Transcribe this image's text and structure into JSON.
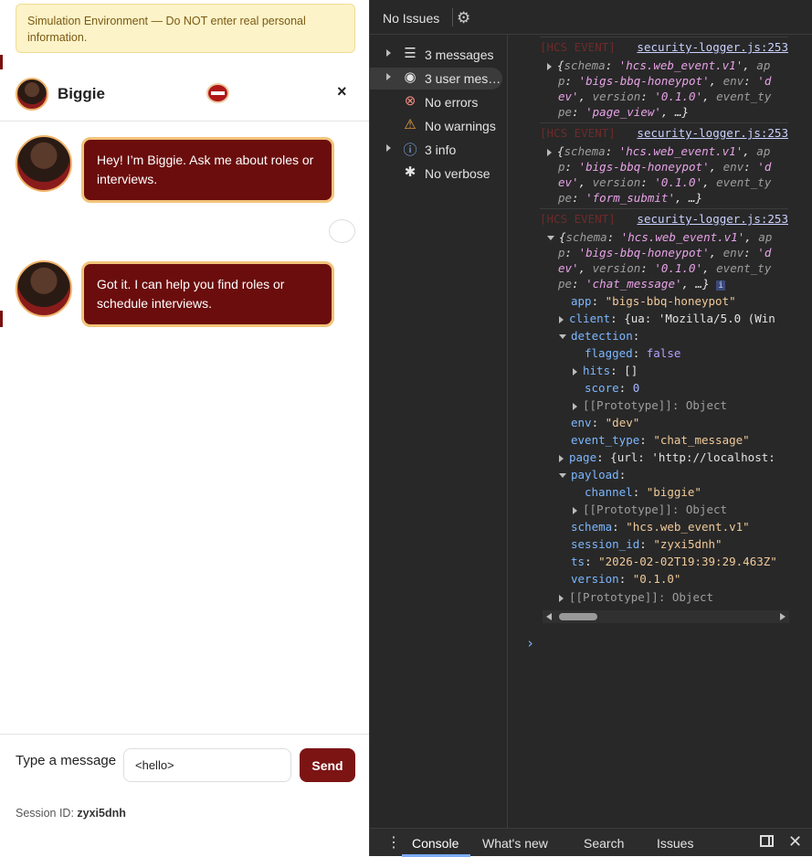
{
  "chat": {
    "banner": "Simulation Environment — Do NOT enter real personal information.",
    "bot_name": "Biggie",
    "close_glyph": "×",
    "messages": [
      {
        "text": "Hey! I’m Biggie. Ask me about roles or interviews."
      },
      {
        "text": "Got it. I can help you find roles or schedule interviews."
      }
    ],
    "composer_label": "Type a message",
    "input_value": "<hello>",
    "send_label": "Send",
    "session_label": "Session ID:",
    "session_id": "zyxi5dnh"
  },
  "devtools": {
    "issues_label": "No Issues",
    "gear_icon": "gear-icon",
    "sidebar": [
      {
        "icon": "list-icon",
        "glyph": "☰",
        "label": "3 messages",
        "expandable": true,
        "selected": false
      },
      {
        "icon": "user-icon",
        "glyph": "◉",
        "label": "3 user mes…",
        "expandable": true,
        "selected": true
      },
      {
        "icon": "error-icon",
        "glyph": "⊗",
        "label": "No errors",
        "expandable": false,
        "selected": false
      },
      {
        "icon": "warning-icon",
        "glyph": "⚠",
        "label": "No warnings",
        "expandable": false,
        "selected": false
      },
      {
        "icon": "info-icon",
        "glyph": "ⓘ",
        "label": "3 info",
        "expandable": true,
        "selected": false
      },
      {
        "icon": "bug-icon",
        "glyph": "✱",
        "label": "No verbose",
        "expandable": false,
        "selected": false
      }
    ],
    "logs": [
      {
        "tag": "[HCS EVENT]",
        "source": "security-logger.js:253",
        "event_type": "page_view"
      },
      {
        "tag": "[HCS EVENT]",
        "source": "security-logger.js:253",
        "event_type": "form_submit"
      },
      {
        "tag": "[HCS EVENT]",
        "source": "security-logger.js:253",
        "event_type": "chat_message"
      }
    ],
    "summary": {
      "schema": "hcs.web_event.v1",
      "app": "bigs-bbq-honeypot",
      "env": "dev",
      "version": "0.1.0"
    },
    "expanded": {
      "app": "\"bigs-bbq-honeypot\"",
      "client": "{ua: 'Mozilla/5.0 (Win",
      "flagged": "false",
      "hits": "[]",
      "score": "0",
      "prototype": "[[Prototype]]: Object",
      "env": "\"dev\"",
      "event_type": "\"chat_message\"",
      "page": "{url: 'http://localhost:",
      "channel": "\"biggie\"",
      "schema": "\"hcs.web_event.v1\"",
      "session_id": "\"zyxi5dnh\"",
      "ts": "\"2026-02-02T19:39:29.463Z\"",
      "version": "\"0.1.0\""
    },
    "bottom_tabs": [
      "Console",
      "What's new",
      "Search",
      "Issues"
    ],
    "prompt_glyph": "›"
  }
}
